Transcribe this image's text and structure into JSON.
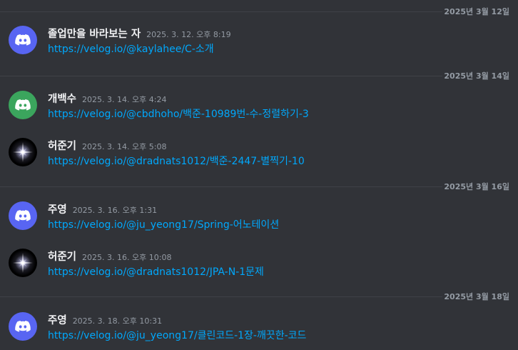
{
  "colors": {
    "background": "#313338",
    "link": "#00a8fc",
    "divider_date": "#949ba4",
    "avatar_blue": "#5865f2",
    "avatar_green": "#3ba55d"
  },
  "dividers": [
    {
      "date": "2025년 3월 12일"
    },
    {
      "date": "2025년 3월 14일"
    },
    {
      "date": "2025년 3월 16일"
    },
    {
      "date": "2025년 3월 18일"
    }
  ],
  "messages": [
    {
      "username": "졸업만을 바라보는 자",
      "timestamp": "2025. 3. 12. 오후 8:19",
      "link": "https://velog.io/@kaylahee/C-소개",
      "avatar_icon": "discord-logo-icon"
    },
    {
      "username": "개백수",
      "timestamp": "2025. 3. 14. 오후 4:24",
      "link": "https://velog.io/@cbdhoho/백준-10989번-수-정렬하기-3",
      "avatar_icon": "discord-logo-icon"
    },
    {
      "username": "허준기",
      "timestamp": "2025. 3. 14. 오후 5:08",
      "link": "https://velog.io/@dradnats1012/백준-2447-별찍기-10",
      "avatar_icon": "star-icon"
    },
    {
      "username": "주영",
      "timestamp": "2025. 3. 16. 오후 1:31",
      "link": "https://velog.io/@ju_yeong17/Spring-어노테이션",
      "avatar_icon": "discord-logo-icon"
    },
    {
      "username": "허준기",
      "timestamp": "2025. 3. 16. 오후 10:08",
      "link": "https://velog.io/@dradnats1012/JPA-N-1문제",
      "avatar_icon": "star-icon"
    },
    {
      "username": "주영",
      "timestamp": "2025. 3. 18. 오후 10:31",
      "link": "https://velog.io/@ju_yeong17/클린코드-1장-깨끗한-코드",
      "avatar_icon": "discord-logo-icon"
    }
  ]
}
